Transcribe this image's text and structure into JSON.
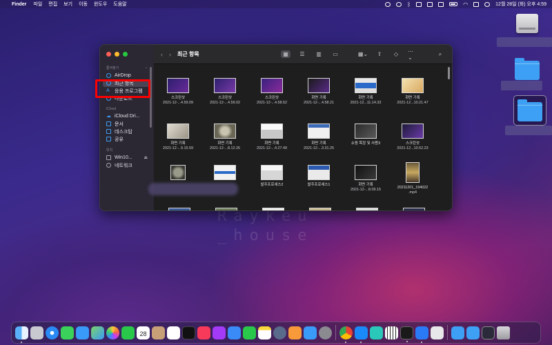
{
  "menubar": {
    "apple": "",
    "app_name": "Finder",
    "items": [
      "파일",
      "편집",
      "보기",
      "이동",
      "윈도우",
      "도움말"
    ],
    "clock": "12월 28일 (화) 오후 4:59"
  },
  "finder": {
    "title": "최근 항목",
    "sidebar": {
      "favorites_header": "즐겨찾기",
      "favorites": [
        {
          "label": "AirDrop",
          "icon": "airdrop-icon"
        },
        {
          "label": "최근 항목",
          "icon": "clock-icon",
          "active": true
        },
        {
          "label": "응용 프로그램",
          "icon": "apps-icon"
        },
        {
          "label": "다운로드",
          "icon": "download-icon"
        }
      ],
      "icloud_header": "iCloud",
      "icloud": [
        {
          "label": "iCloud Dri...",
          "icon": "cloud-icon"
        },
        {
          "label": "문서",
          "icon": "document-icon"
        },
        {
          "label": "데스크탑",
          "icon": "desktop-icon"
        },
        {
          "label": "공유",
          "icon": "shared-folder-icon"
        }
      ],
      "locations_header": "위치",
      "locations": [
        {
          "label": "Win10...",
          "icon": "drive-icon",
          "eject": "⏏"
        },
        {
          "label": "네트워크",
          "icon": "network-icon"
        }
      ]
    },
    "items": [
      {
        "name": "스크린샷",
        "sub": "2021-12-...4.59.09"
      },
      {
        "name": "스크린샷",
        "sub": "2021-12-...4.59.02"
      },
      {
        "name": "스크린샷",
        "sub": "2021-12-...4.58.52"
      },
      {
        "name": "화면 기록",
        "sub": "2021-12-...4.58.21"
      },
      {
        "name": "화면 기록",
        "sub": "2021-12...11.14.33"
      },
      {
        "name": "화면 기록",
        "sub": "2021-12...10.21.47"
      },
      {
        "name": "화면 기록",
        "sub": "2021-12-...9.15.59"
      },
      {
        "name": "화면 기록",
        "sub": "2021-12-...8.12.26"
      },
      {
        "name": "화면 기록",
        "sub": "2021-12-...4.27.49"
      },
      {
        "name": "화면 기록",
        "sub": "2021-12-...3.31.25"
      },
      {
        "name": "쇼핑 목장 및 사용3",
        "sub": ""
      },
      {
        "name": "스크린샷",
        "sub": "2021-12...10.52.23"
      },
      {
        "name": "",
        "sub": ""
      },
      {
        "name": "",
        "sub": ""
      },
      {
        "name": "발주프로세스2",
        "sub": ""
      },
      {
        "name": "발주프로세스1",
        "sub": ""
      },
      {
        "name": "화면 기록",
        "sub": "2021-12-...8.09.15"
      },
      {
        "name": "20211201_194022",
        "sub": ".mp4"
      }
    ]
  },
  "watermark": {
    "line1": "Raykeu",
    "line2": "_house"
  },
  "colors": {
    "highlight": "#ff0000",
    "accent": "#3ea0f4"
  }
}
